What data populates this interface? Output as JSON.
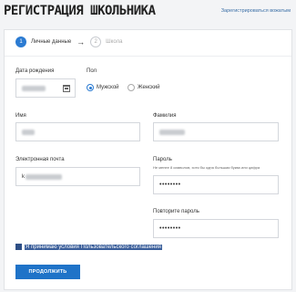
{
  "header": {
    "title": "РЕГИСТРАЦИЯ ШКОЛЬНИКА",
    "login_link": "Зарегистрироваться вожатым"
  },
  "steps": [
    {
      "number": "1",
      "label": "Личные данные",
      "active": true
    },
    {
      "number": "2",
      "label": "Школа",
      "active": false
    }
  ],
  "form": {
    "birth_date": {
      "label": "Дата рождения"
    },
    "gender": {
      "label": "Пол",
      "options": [
        "Мужской",
        "Женский"
      ],
      "selected": "Мужской"
    },
    "first_name": {
      "label": "Имя"
    },
    "last_name": {
      "label": "Фамилия"
    },
    "email": {
      "label": "Электронная почта",
      "value_prefix": "k"
    },
    "password": {
      "label": "Пароль",
      "hint": "Не менее 8 символов, хотя бы одна большая буква или цифра",
      "value": "••••••••"
    },
    "password_repeat": {
      "label": "Повторите пароль",
      "value": "••••••••"
    },
    "agree_label": "Я принимаю условия Пользовательского соглашения",
    "submit_label": "ПРОДОЛЖИТЬ"
  },
  "colors": {
    "accent": "#2b7bd2",
    "button": "#1f73c8",
    "agree_highlight": "#3a5e9a",
    "background": "#f3f4f6"
  },
  "icons": {
    "calendar": "calendar-icon",
    "step_arrow": "arrow-right-icon"
  }
}
